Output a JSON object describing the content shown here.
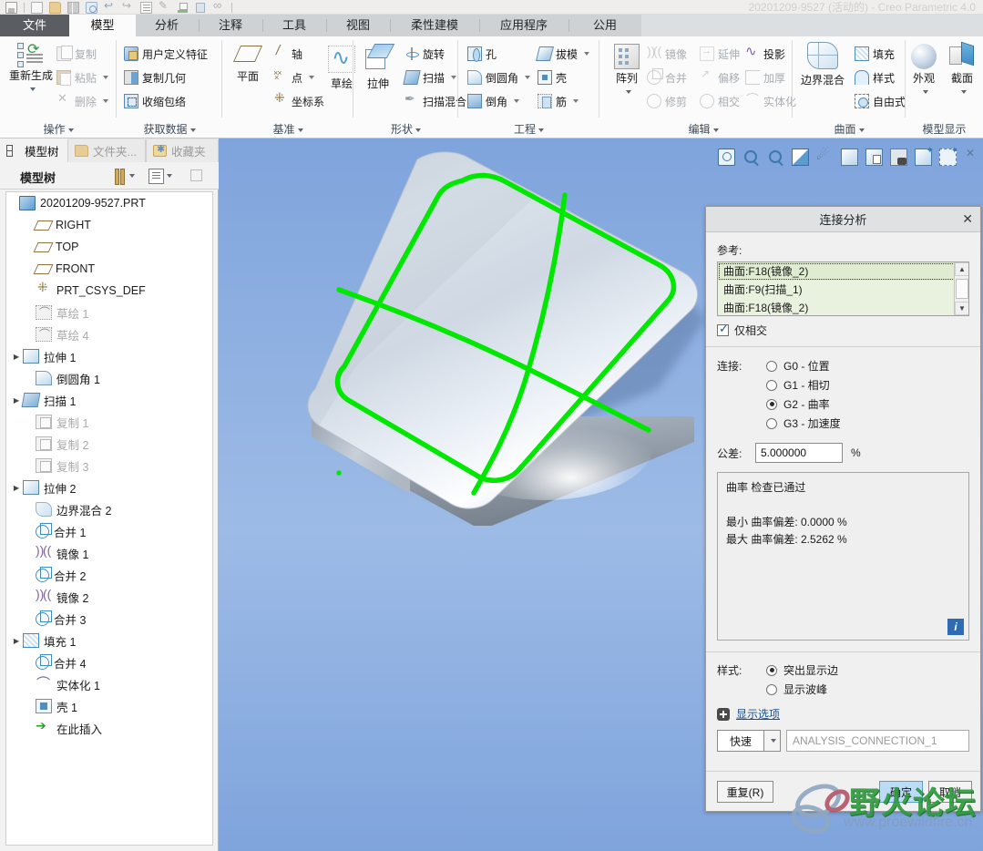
{
  "window": {
    "title": "20201209-9527 (活动的) - Creo Parametric 4.0"
  },
  "quick_access": {
    "items": [
      {
        "name": "save-icon",
        "label": "保存"
      },
      {
        "name": "new-icon",
        "label": "新建"
      },
      {
        "name": "open-icon",
        "label": "打开"
      },
      {
        "name": "close-window-icon",
        "label": "关闭窗口"
      },
      {
        "name": "regenerate-icon",
        "label": "重新生成"
      },
      {
        "name": "undo-icon",
        "label": "撤销"
      },
      {
        "name": "redo-icon",
        "label": "重做"
      },
      {
        "name": "list-icon",
        "label": "列表"
      },
      {
        "name": "edit-icon",
        "label": "编辑"
      },
      {
        "name": "green-plane-icon",
        "label": "基准平面显示"
      },
      {
        "name": "blue-window-icon",
        "label": "窗口"
      },
      {
        "name": "glasses-icon",
        "label": "显示"
      }
    ]
  },
  "ribbon": {
    "tabs": [
      {
        "label": "文件",
        "kind": "file"
      },
      {
        "label": "模型",
        "kind": "active"
      },
      {
        "label": "分析",
        "kind": "normal"
      },
      {
        "label": "注释",
        "kind": "normal"
      },
      {
        "label": "工具",
        "kind": "normal"
      },
      {
        "label": "视图",
        "kind": "normal"
      },
      {
        "label": "柔性建模",
        "kind": "normal"
      },
      {
        "label": "应用程序",
        "kind": "normal"
      },
      {
        "label": "公用",
        "kind": "normal"
      }
    ],
    "groups": [
      {
        "name": "operations",
        "label": "操作",
        "has_caret": true,
        "big": {
          "label": "重新生成",
          "icon": "regenerate-icon",
          "has_caret": true
        },
        "items": [
          {
            "label": "复制",
            "icon": "copy-icon",
            "dim": true,
            "caret": false
          },
          {
            "label": "粘贴",
            "icon": "paste-icon",
            "dim": true,
            "caret": true
          },
          {
            "label": "删除",
            "icon": "delete-icon",
            "dim": true,
            "caret": true
          }
        ]
      },
      {
        "name": "get-data",
        "label": "获取数据",
        "has_caret": true,
        "items": [
          {
            "label": "用户定义特征",
            "icon": "udf-icon",
            "dim": false,
            "caret": false
          },
          {
            "label": "复制几何",
            "icon": "copy-geometry-icon",
            "dim": false,
            "caret": false
          },
          {
            "label": "收缩包络",
            "icon": "shrinkwrap-icon",
            "dim": false,
            "caret": false
          }
        ]
      },
      {
        "name": "datum",
        "label": "基准",
        "has_caret": true,
        "big": {
          "label": "平面",
          "icon": "datum-plane-icon",
          "has_caret": false
        },
        "items": [
          {
            "label": "轴",
            "icon": "datum-axis-icon",
            "dim": false,
            "caret": false
          },
          {
            "label": "点",
            "icon": "datum-point-icon",
            "dim": false,
            "caret": true
          },
          {
            "label": "坐标系",
            "icon": "coordinate-system-icon",
            "dim": false,
            "caret": false
          }
        ],
        "big2": {
          "label": "草绘",
          "icon": "sketch-icon"
        }
      },
      {
        "name": "shapes",
        "label": "形状",
        "has_caret": true,
        "big": {
          "label": "拉伸",
          "icon": "extrude-icon",
          "has_caret": false
        },
        "items": [
          {
            "label": "旋转",
            "icon": "revolve-icon",
            "dim": false,
            "caret": false
          },
          {
            "label": "扫描",
            "icon": "sweep-icon",
            "dim": false,
            "caret": true
          },
          {
            "label": "扫描混合",
            "icon": "swept-blend-icon",
            "dim": false,
            "caret": false
          }
        ]
      },
      {
        "name": "engineering",
        "label": "工程",
        "has_caret": true,
        "items_left": [
          {
            "label": "孔",
            "icon": "hole-icon",
            "dim": false,
            "caret": false
          },
          {
            "label": "倒圆角",
            "icon": "round-icon",
            "dim": false,
            "caret": true
          },
          {
            "label": "倒角",
            "icon": "chamfer-icon",
            "dim": false,
            "caret": true
          }
        ],
        "items_right": [
          {
            "label": "拔模",
            "icon": "draft-icon",
            "dim": false,
            "caret": true
          },
          {
            "label": "壳",
            "icon": "shell-icon",
            "dim": false,
            "caret": false
          },
          {
            "label": "筋",
            "icon": "rib-icon",
            "dim": false,
            "caret": true
          }
        ]
      },
      {
        "name": "editing",
        "label": "编辑",
        "has_caret": true,
        "big": {
          "label": "阵列",
          "icon": "pattern-icon",
          "has_caret": true
        },
        "col1": [
          {
            "label": "镜像",
            "icon": "mirror-icon",
            "dim": true
          },
          {
            "label": "合并",
            "icon": "merge-icon",
            "dim": true
          },
          {
            "label": "修剪",
            "icon": "trim-icon",
            "dim": true
          }
        ],
        "col2": [
          {
            "label": "延伸",
            "icon": "extend-icon",
            "dim": true
          },
          {
            "label": "偏移",
            "icon": "offset-icon",
            "dim": true
          },
          {
            "label": "相交",
            "icon": "intersect-icon",
            "dim": true
          }
        ],
        "col3": [
          {
            "label": "投影",
            "icon": "project-icon",
            "dim": false
          },
          {
            "label": "加厚",
            "icon": "thicken-icon",
            "dim": true
          },
          {
            "label": "实体化",
            "icon": "solidify-icon",
            "dim": true
          }
        ]
      },
      {
        "name": "surfaces",
        "label": "曲面",
        "has_caret": true,
        "big": {
          "label": "边界混合",
          "icon": "boundary-blend-icon",
          "has_caret": false
        },
        "items": [
          {
            "label": "填充",
            "icon": "fill-icon",
            "dim": false,
            "caret": false
          },
          {
            "label": "样式",
            "icon": "style-icon",
            "dim": false,
            "caret": false
          },
          {
            "label": "自由式",
            "icon": "freestyle-icon",
            "dim": false,
            "caret": false
          }
        ]
      },
      {
        "name": "model-display",
        "label": "模型显示",
        "has_caret": false,
        "big": {
          "label": "外观",
          "icon": "appearance-icon",
          "has_caret": true
        },
        "big2": {
          "label": "截面",
          "icon": "section-icon",
          "has_caret": true
        }
      }
    ]
  },
  "nav": {
    "tabs": [
      {
        "label": "模型树",
        "icon": "model-tree-icon",
        "active": true
      },
      {
        "label": "文件夹...",
        "icon": "folder-icon",
        "active": false
      },
      {
        "label": "收藏夹",
        "icon": "favorites-icon",
        "active": false
      }
    ],
    "toolbar": {
      "title": "模型树",
      "buttons": [
        {
          "name": "settings-tools-icon",
          "caret": true
        },
        {
          "name": "display-list-icon",
          "caret": true
        },
        {
          "name": "filter-icon",
          "caret": false
        }
      ]
    },
    "tree": [
      {
        "label": "20201209-9527.PRT",
        "icon": "part-icon",
        "indent": 0,
        "expand": "",
        "dim": false
      },
      {
        "label": "RIGHT",
        "icon": "datum-plane-icon",
        "indent": 1,
        "expand": "",
        "dim": false
      },
      {
        "label": "TOP",
        "icon": "datum-plane-icon",
        "indent": 1,
        "expand": "",
        "dim": false
      },
      {
        "label": "FRONT",
        "icon": "datum-plane-icon",
        "indent": 1,
        "expand": "",
        "dim": false
      },
      {
        "label": "PRT_CSYS_DEF",
        "icon": "coordinate-system-icon",
        "indent": 1,
        "expand": "",
        "dim": false
      },
      {
        "label": "草绘 1",
        "icon": "sketch-icon",
        "indent": 1,
        "expand": "",
        "dim": true
      },
      {
        "label": "草绘 4",
        "icon": "sketch-icon",
        "indent": 1,
        "expand": "",
        "dim": true
      },
      {
        "label": "拉伸 1",
        "icon": "extrude-icon",
        "indent": 1,
        "expand": "▶",
        "dim": false
      },
      {
        "label": "倒圆角 1",
        "icon": "round-icon",
        "indent": 1,
        "expand": "",
        "dim": false
      },
      {
        "label": "扫描 1",
        "icon": "sweep-icon",
        "indent": 1,
        "expand": "▶",
        "dim": false
      },
      {
        "label": "复制 1",
        "icon": "copy-icon",
        "indent": 1,
        "expand": "",
        "dim": true
      },
      {
        "label": "复制 2",
        "icon": "copy-icon",
        "indent": 1,
        "expand": "",
        "dim": true
      },
      {
        "label": "复制 3",
        "icon": "copy-icon",
        "indent": 1,
        "expand": "",
        "dim": true
      },
      {
        "label": "拉伸 2",
        "icon": "extrude-icon",
        "indent": 1,
        "expand": "▶",
        "dim": false
      },
      {
        "label": "边界混合 2",
        "icon": "boundary-blend-icon",
        "indent": 1,
        "expand": "",
        "dim": false
      },
      {
        "label": "合并 1",
        "icon": "merge-icon",
        "indent": 1,
        "expand": "",
        "dim": false
      },
      {
        "label": "镜像 1",
        "icon": "mirror-icon",
        "indent": 1,
        "expand": "",
        "dim": false
      },
      {
        "label": "合并 2",
        "icon": "merge-icon",
        "indent": 1,
        "expand": "",
        "dim": false
      },
      {
        "label": "镜像 2",
        "icon": "mirror-icon",
        "indent": 1,
        "expand": "",
        "dim": false
      },
      {
        "label": "合并 3",
        "icon": "merge-icon",
        "indent": 1,
        "expand": "",
        "dim": false
      },
      {
        "label": "填充 1",
        "icon": "fill-icon",
        "indent": 1,
        "expand": "▶",
        "dim": false
      },
      {
        "label": "合并 4",
        "icon": "merge-icon",
        "indent": 1,
        "expand": "",
        "dim": false
      },
      {
        "label": "实体化 1",
        "icon": "solidify-icon",
        "indent": 1,
        "expand": "",
        "dim": false
      },
      {
        "label": "壳 1",
        "icon": "shell-icon",
        "indent": 1,
        "expand": "",
        "dim": false
      },
      {
        "label": "在此插入",
        "icon": "insert-here-icon",
        "indent": 1,
        "expand": "",
        "dim": false
      }
    ]
  },
  "viewport": {
    "background_top": "#7fa4dc",
    "background_mid": "#9dbbe6",
    "curve_color": "#00e800",
    "graphics_toolbar": [
      {
        "name": "zoom-to-selection-icon",
        "label": "选择框缩放"
      },
      {
        "name": "zoom-in-icon",
        "label": "放大"
      },
      {
        "name": "zoom-out-icon",
        "label": "缩小"
      },
      {
        "name": "refit-icon",
        "label": "重新调整"
      },
      {
        "name": "drag-icon",
        "label": "拖动"
      },
      {
        "name": "display-style-icon",
        "label": "显示样式"
      },
      {
        "name": "saved-views-icon",
        "label": "已保存方向"
      },
      {
        "name": "view-manager-icon",
        "label": "视图管理器"
      },
      {
        "name": "annotation-display-icon",
        "label": "注释显示"
      },
      {
        "name": "spin-center-icon",
        "label": "旋转中心"
      },
      {
        "name": "close-toolbar-icon",
        "label": "关闭"
      }
    ]
  },
  "dialog": {
    "title": "连接分析",
    "close_label": "✕",
    "reference_label": "参考:",
    "references": [
      {
        "text": "曲面:F18(镜像_2)",
        "selected": true
      },
      {
        "text": "曲面:F9(扫描_1)",
        "selected": false
      },
      {
        "text": "曲面:F18(镜像_2)",
        "selected": false
      }
    ],
    "intersect_only": {
      "label": "仅相交",
      "checked": true
    },
    "connection_label": "连接:",
    "connection_options": [
      {
        "label": "G0 - 位置",
        "selected": false
      },
      {
        "label": "G1 - 相切",
        "selected": false
      },
      {
        "label": "G2 - 曲率",
        "selected": true
      },
      {
        "label": "G3 - 加速度",
        "selected": false
      }
    ],
    "tolerance_label": "公差:",
    "tolerance_value": "5.000000",
    "tolerance_unit": "%",
    "result": {
      "status": "曲率 检查已通过",
      "min_line": "最小 曲率偏差: 0.0000 %",
      "max_line": "最大 曲率偏差: 2.5262 %",
      "info_button": "i"
    },
    "style_label": "样式:",
    "style_options": [
      {
        "label": "突出显示边",
        "selected": true
      },
      {
        "label": "显示波峰",
        "selected": false
      }
    ],
    "display_options_label": "显示选项",
    "quick_select": "快速",
    "analysis_name_placeholder": "ANALYSIS_CONNECTION_1",
    "buttons": {
      "repeat": "重复(R)",
      "ok": "确定",
      "cancel": "取消"
    }
  },
  "watermark": {
    "text": "野火论坛",
    "url": "www.proewildfire.cn"
  }
}
